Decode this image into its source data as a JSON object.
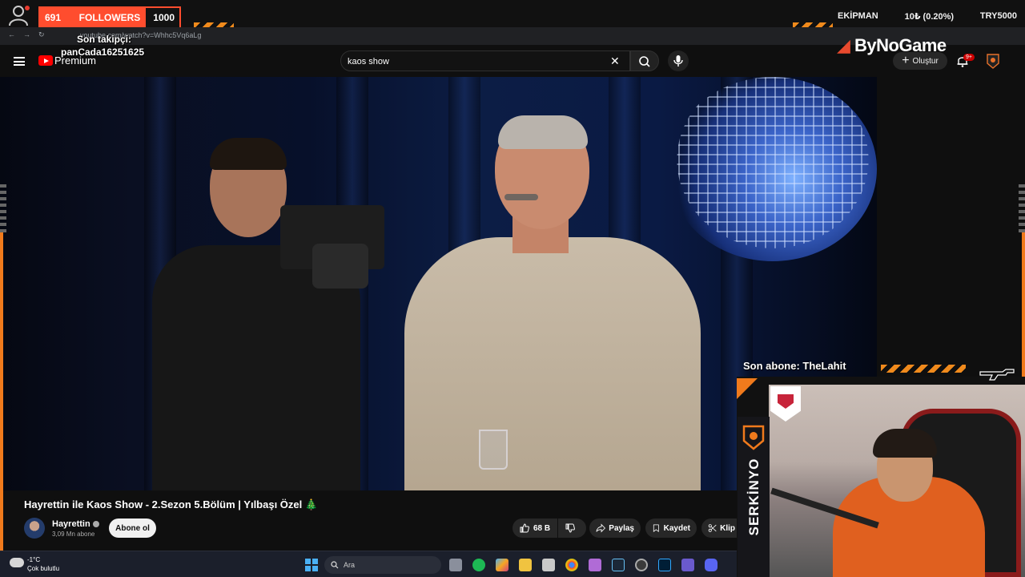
{
  "overlay": {
    "followers_count": "691",
    "followers_label": "FOLLOWERS",
    "followers_goal": "1000",
    "son_takipci_label": "Son takipçi:",
    "son_takipci_name": "panCada16251625",
    "stat_ekipman": "EKİPMAN",
    "stat_change": "10₺ (0.20%)",
    "stat_try": "TRY5000",
    "brand": "ByNoGame",
    "son_abone": "Son abone: TheLahit",
    "streamer": "SERKİNYO"
  },
  "browser": {
    "url": "youtube.com/watch?v=Whhc5Vq6aLg"
  },
  "youtube": {
    "logo_text": "Premium",
    "search_value": "kaos show",
    "create_label": "Oluştur",
    "bell_badge": "9+"
  },
  "video": {
    "title": "Hayrettin ile Kaos Show - 2.Sezon 5.Bölüm | Yılbaşı Özel 🎄",
    "channel": "Hayrettin",
    "subscribers": "3,09 Mn abone",
    "subscribe_label": "Abone ol",
    "likes": "68 B",
    "share_label": "Paylaş",
    "save_label": "Kaydet",
    "clip_label": "Klip"
  },
  "taskbar": {
    "temperature": "-1°C",
    "weather": "Çok bulutlu",
    "search_placeholder": "Ara"
  },
  "colors": {
    "accent_orange": "#f08a1c",
    "follower_red": "#ff4d2e",
    "yt_red": "#ff0000"
  }
}
